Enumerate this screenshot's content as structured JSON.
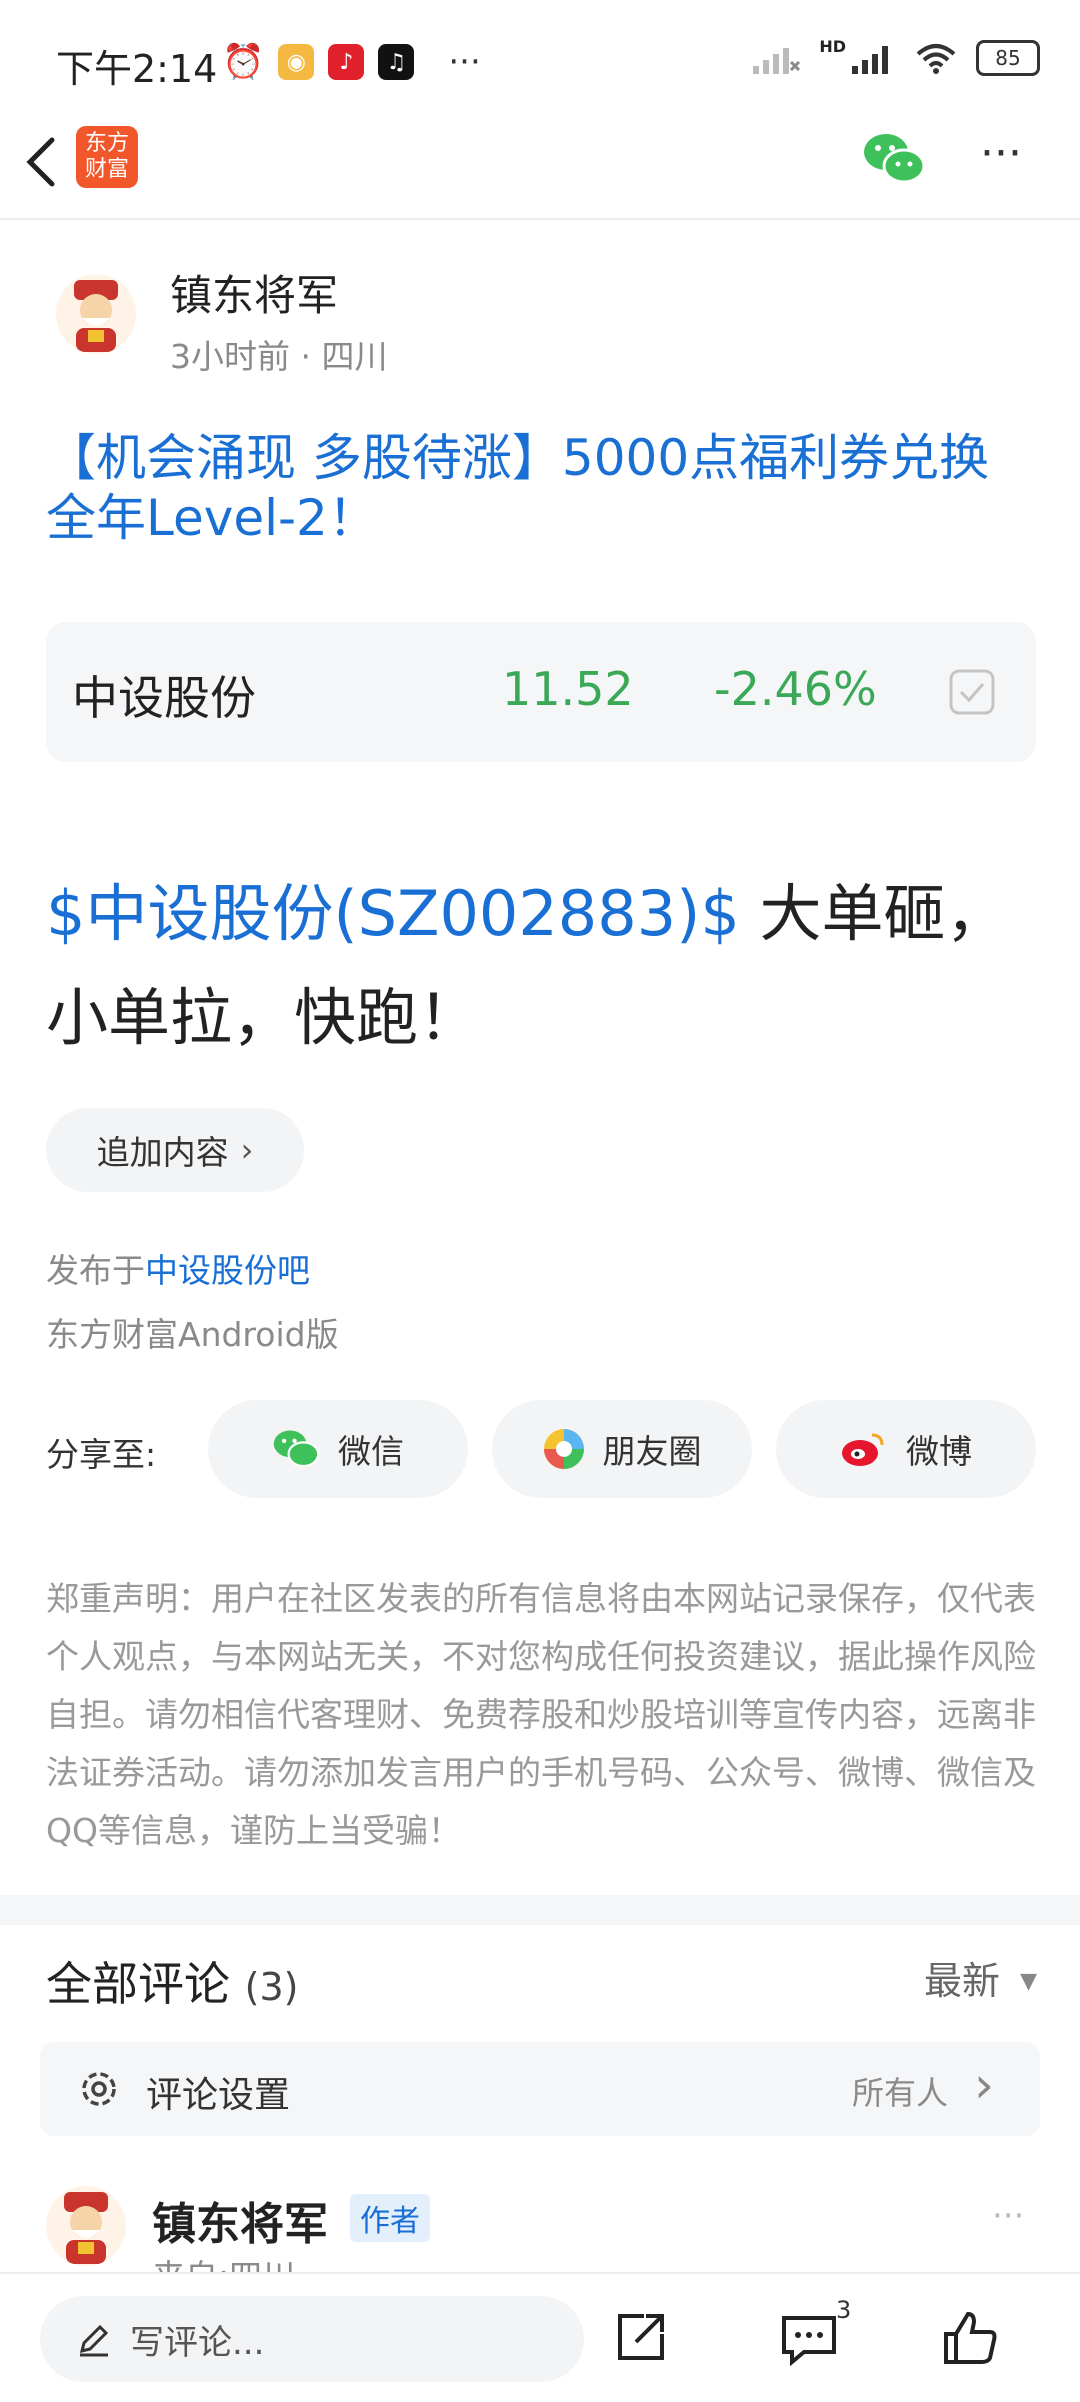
{
  "status": {
    "time": "下午2:14",
    "battery": "85",
    "network": "HD"
  },
  "header": {
    "logo_text": "东方财富"
  },
  "post": {
    "author": "镇东将军",
    "meta": "3小时前 · 四川",
    "title": "【机会涌现 多股待涨】5000点福利券兑换全年Level-2！",
    "quote": {
      "name": "中设股份",
      "price": "11.52",
      "change": "-2.46%"
    },
    "content_stock": "$中设股份(SZ002883)$",
    "content_text": " 大单砸，小单拉，快跑！",
    "append_button": "追加内容",
    "published_prefix": "发布于",
    "published_bar": "中设股份吧",
    "client": "东方财富Android版"
  },
  "share": {
    "label": "分享至:",
    "wechat": "微信",
    "moments": "朋友圈",
    "weibo": "微博"
  },
  "disclaimer": "郑重声明：用户在社区发表的所有信息将由本网站记录保存，仅代表个人观点，与本网站无关，不对您构成任何投资建议，据此操作风险自担。请勿相信代客理财、免费荐股和炒股培训等宣传内容，远离非法证券活动。请勿添加发言用户的手机号码、公众号、微博、微信及QQ等信息，谨防上当受骗！",
  "comments": {
    "title": "全部评论",
    "count": "(3)",
    "sort": "最新",
    "settings_label": "评论设置",
    "settings_value": "所有人",
    "first": {
      "author": "镇东将军",
      "badge": "作者",
      "meta": "来自:四川"
    }
  },
  "bottom": {
    "write_placeholder": "写评论...",
    "comment_count": "3"
  },
  "colors": {
    "link": "#1a6fd4",
    "down": "#3aa856",
    "brand": "#f2572b"
  }
}
